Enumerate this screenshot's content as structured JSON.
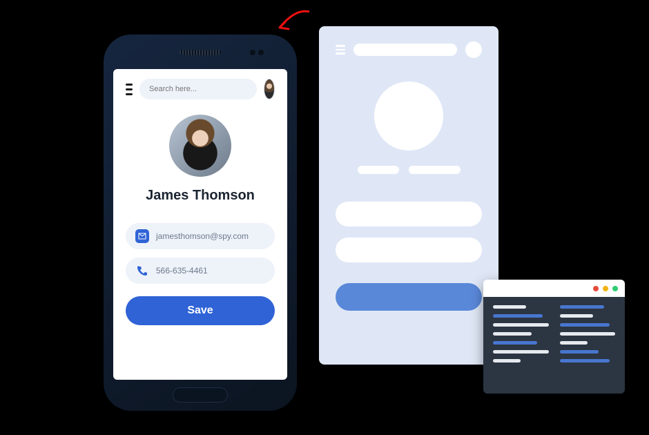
{
  "topbar": {
    "search_placeholder": "Search here..."
  },
  "profile": {
    "name": "James Thomson",
    "email": "jamesthomson@spy.com",
    "phone": "566-635-4461",
    "save_label": "Save"
  },
  "icons": {
    "menu": "menu-icon",
    "avatar_small": "avatar-small",
    "avatar_large": "avatar-large",
    "mail": "mail-icon",
    "phone": "phone-icon",
    "arrow": "arrow-icon"
  },
  "colors": {
    "accent": "#2f63d6",
    "field_bg": "#eef2f9",
    "wireframe_bg": "#dfe7f6",
    "code_bg": "#2c3542"
  }
}
